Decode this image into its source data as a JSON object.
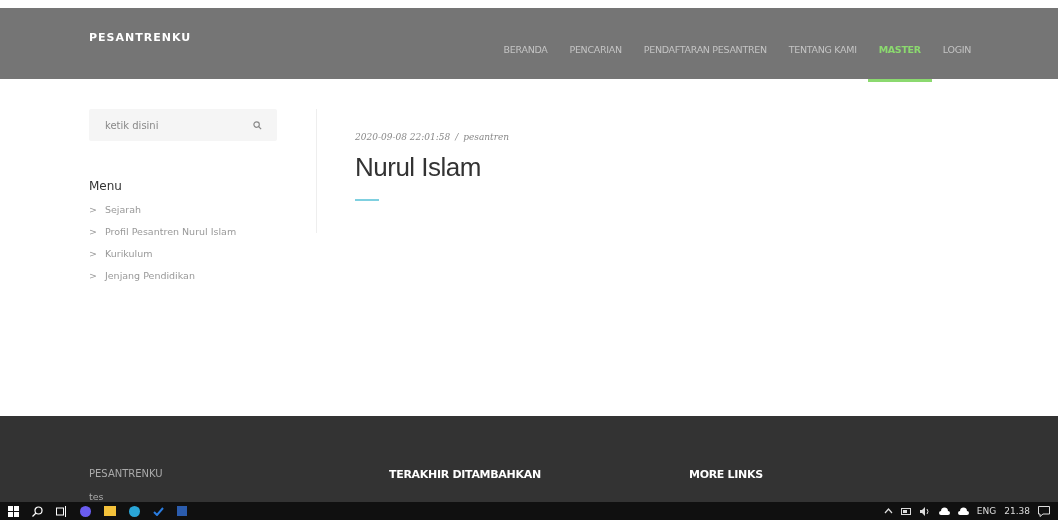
{
  "header": {
    "brand": "PESANTRENKU",
    "nav": [
      {
        "label": "BERANDA",
        "selected": false
      },
      {
        "label": "PENCARIAN",
        "selected": false
      },
      {
        "label": "PENDAFTARAN PESANTREN",
        "selected": false
      },
      {
        "label": "TENTANG KAMI",
        "selected": false
      },
      {
        "label": "MASTER",
        "selected": true
      },
      {
        "label": "LOGIN",
        "selected": false
      }
    ]
  },
  "sidebar": {
    "search": {
      "placeholder": "ketik disini"
    },
    "menu_title": "Menu",
    "menu_items": [
      {
        "marker": ">",
        "label": "Sejarah"
      },
      {
        "marker": ">",
        "label": "Profil Pesantren Nurul Islam"
      },
      {
        "marker": ">",
        "label": "Kurikulum"
      },
      {
        "marker": ">",
        "label": "Jenjang Pendidikan"
      }
    ]
  },
  "article": {
    "date": "2020-09-08 22:01:58",
    "separator": "/",
    "author": "pesantren",
    "title": "Nurul Islam"
  },
  "footer": {
    "brand": "PESANTRENKU",
    "text": "tes",
    "headings": [
      "TERAKHIR DITAMBAHKAN",
      "MORE LINKS"
    ]
  },
  "taskbar": {
    "language": "ENG",
    "time": "21.38"
  }
}
